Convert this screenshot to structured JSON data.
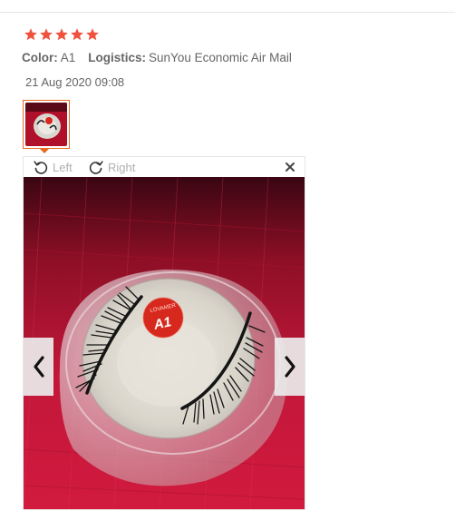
{
  "review": {
    "rating": 5,
    "rating_max": 5,
    "star_color": "#f0523e",
    "color_label": "Color:",
    "color_value": "A1",
    "logistics_label": "Logistics:",
    "logistics_value": "SunYou Economic Air Mail",
    "date": "21 Aug 2020 09:08"
  },
  "viewer": {
    "rotate_left_label": "Left",
    "rotate_right_label": "Right",
    "product_badge_text": "A1",
    "product_badge_brand": "LOVAMER",
    "accent_color": "#e66a1f"
  },
  "icons": {
    "rotate_left": "rotate-left-icon",
    "rotate_right": "rotate-right-icon",
    "close": "close-icon",
    "prev": "chevron-left-icon",
    "next": "chevron-right-icon"
  }
}
